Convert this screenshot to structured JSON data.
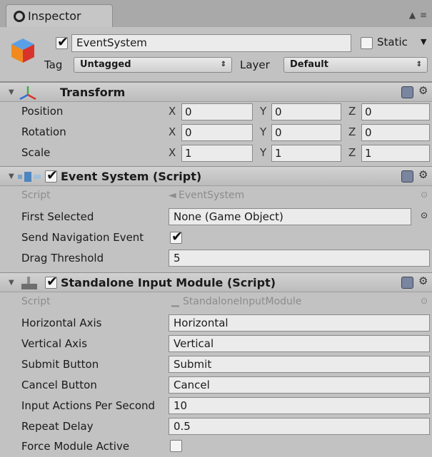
{
  "tab": {
    "label": "Inspector",
    "icon": "info-icon",
    "window_controls": "▲ ≡"
  },
  "header": {
    "object_icon": "cube-icon",
    "active": true,
    "name": "EventSystem",
    "static_label": "Static",
    "static_checked": false,
    "tag_label": "Tag",
    "tag_value": "Untagged",
    "layer_label": "Layer",
    "layer_value": "Default"
  },
  "transform": {
    "icon": "transform-axes-icon",
    "title": "Transform",
    "rows": [
      {
        "label": "Position",
        "x": "0",
        "y": "0",
        "z": "0"
      },
      {
        "label": "Rotation",
        "x": "0",
        "y": "0",
        "z": "0"
      },
      {
        "label": "Scale",
        "x": "1",
        "y": "1",
        "z": "1"
      }
    ],
    "axis_labels": {
      "x": "X",
      "y": "Y",
      "z": "Z"
    }
  },
  "event_system": {
    "icon": "event-system-icon",
    "enabled": true,
    "title": "Event System (Script)",
    "script_label": "Script",
    "script_value": "EventSystem",
    "first_selected_label": "First Selected",
    "first_selected_value": "None (Game Object)",
    "send_nav_label": "Send Navigation Event",
    "send_nav_checked": true,
    "drag_threshold_label": "Drag Threshold",
    "drag_threshold_value": "5"
  },
  "input_module": {
    "icon": "input-module-icon",
    "enabled": true,
    "title": "Standalone Input Module (Script)",
    "script_label": "Script",
    "script_value": "StandaloneInputModule",
    "fields": [
      {
        "label": "Horizontal Axis",
        "value": "Horizontal"
      },
      {
        "label": "Vertical Axis",
        "value": "Vertical"
      },
      {
        "label": "Submit Button",
        "value": "Submit"
      },
      {
        "label": "Cancel Button",
        "value": "Cancel"
      },
      {
        "label": "Input Actions Per Second",
        "value": "10"
      },
      {
        "label": "Repeat Delay",
        "value": "0.5"
      }
    ],
    "force_label": "Force Module Active",
    "force_checked": false
  },
  "colors": {
    "panel": "#c2c2c2",
    "field": "#ebebeb",
    "header": "#bcbcbc",
    "tabbar": "#a9a9a9"
  }
}
